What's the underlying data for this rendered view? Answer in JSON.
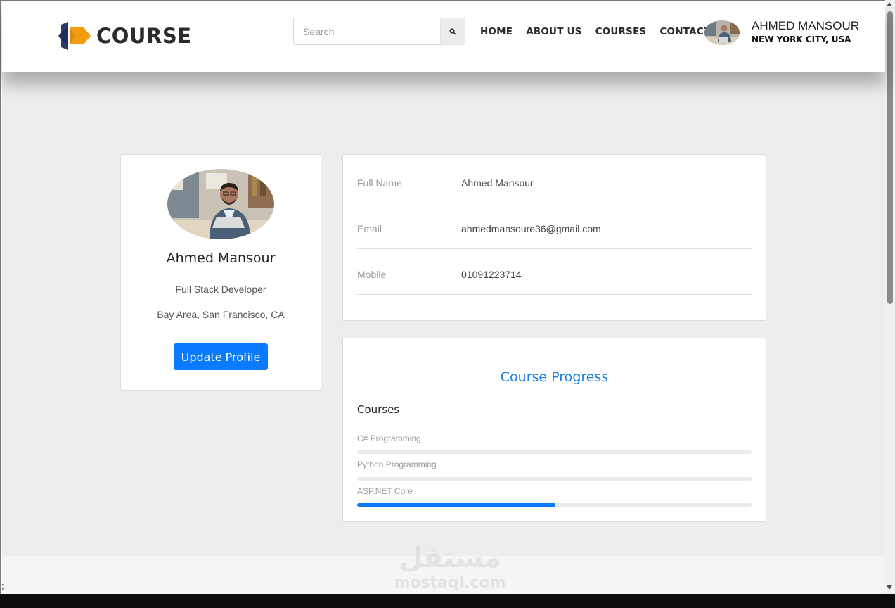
{
  "header": {
    "logo_text": "COURSE",
    "search_placeholder": "Search",
    "search_icon": "search-icon",
    "nav": [
      "HOME",
      "ABOUT US",
      "COURSES",
      "CONTACT"
    ],
    "user_name": "AHMED MANSOUR",
    "user_location": "NEW YORK CITY, USA"
  },
  "profile": {
    "name": "Ahmed Mansour",
    "role": "Full Stack Developer",
    "location": "Bay Area, San Francisco, CA",
    "button_label": "Update Profile"
  },
  "info": {
    "rows": [
      {
        "label": "Full Name",
        "value": "Ahmed Mansour"
      },
      {
        "label": "Email",
        "value": "ahmedmansoure36@gmail.com"
      },
      {
        "label": "Mobile",
        "value": "01091223714"
      }
    ]
  },
  "progress": {
    "title": "Course Progress",
    "heading": "Courses",
    "courses": [
      {
        "label": "C# Programming",
        "percent": 0
      },
      {
        "label": "Python Programming",
        "percent": 0
      },
      {
        "label": "ASP.NET Core",
        "percent": 50
      }
    ]
  },
  "watermark": {
    "arabic": "مستقل",
    "latin": "mostaql.com"
  },
  "misc": {
    "stray_text": ";"
  },
  "colors": {
    "accent": "#0a7bfe",
    "title_blue": "#1a7fe3",
    "logo_orange": "#f39c12",
    "logo_navy": "#2b3a67"
  }
}
